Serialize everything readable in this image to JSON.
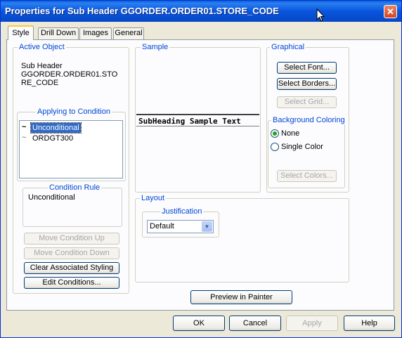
{
  "window": {
    "title": "Properties for Sub Header GGORDER.ORDER01.STORE_CODE",
    "close_glyph": "✕"
  },
  "tabs": [
    {
      "label": "Style",
      "active": true
    },
    {
      "label": "Drill Down"
    },
    {
      "label": "Images"
    },
    {
      "label": "General"
    }
  ],
  "active_object": {
    "legend": "Active Object",
    "line1": "Sub Header",
    "line2": "GGORDER.ORDER01.STO",
    "line3": "RE_CODE"
  },
  "applying": {
    "legend": "Applying to Condition",
    "items": [
      {
        "label": "Unconditional",
        "selected": true,
        "glyph": "~"
      },
      {
        "label": "ORDGT300",
        "selected": false,
        "glyph": "~"
      }
    ]
  },
  "condition_rule": {
    "legend": "Condition Rule",
    "text": "Unconditional"
  },
  "left_buttons": {
    "move_up": "Move Condition Up",
    "move_down": "Move Condition Down",
    "clear": "Clear Associated Styling",
    "edit": "Edit Conditions..."
  },
  "sample": {
    "legend": "Sample",
    "text": "SubHeading Sample Text"
  },
  "graphical": {
    "legend": "Graphical",
    "select_font": "Select Font...",
    "select_borders": "Select Borders...",
    "select_grid": "Select Grid...",
    "bg_legend": "Background Coloring",
    "none_label": "None",
    "single_label": "Single Color",
    "select_colors": "Select Colors..."
  },
  "layout": {
    "legend": "Layout",
    "just_legend": "Justification",
    "value": "Default"
  },
  "preview_button": "Preview in Painter",
  "dialog_buttons": {
    "ok": "OK",
    "cancel": "Cancel",
    "apply": "Apply",
    "help": "Help"
  },
  "colors": {
    "title_bar": "#0855dd",
    "legend_text": "#0046d5",
    "selection": "#316ac5"
  },
  "icons": [
    "close-icon",
    "mouse-cursor-icon",
    "condition-glyph-icon",
    "dropdown-arrow-icon"
  ]
}
